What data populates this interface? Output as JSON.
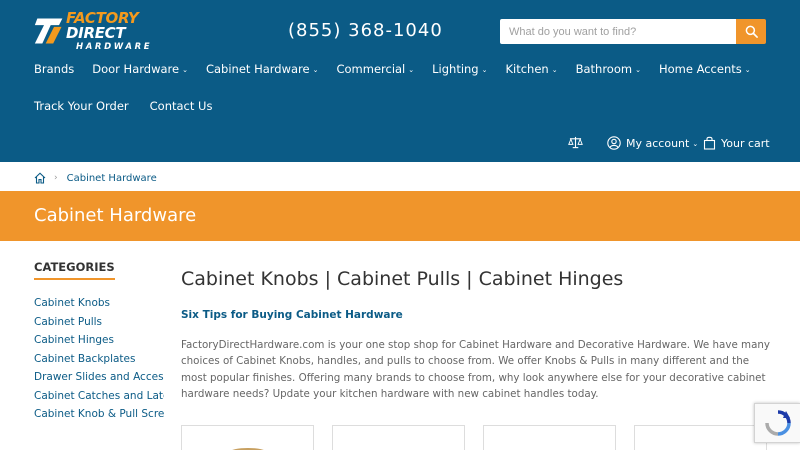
{
  "brand": {
    "logo_line1a": "FACTORY",
    "logo_line1b": "DIRECT",
    "logo_line2": "HARDWARE",
    "accent_color": "#f0952b",
    "primary_color": "#0b5b86"
  },
  "header": {
    "phone": "(855) 368-1040",
    "search_placeholder": "What do you want to find?",
    "search_icon": "search-icon"
  },
  "nav": {
    "row1": [
      {
        "label": "Brands",
        "dropdown": false
      },
      {
        "label": "Door Hardware",
        "dropdown": true
      },
      {
        "label": "Cabinet Hardware",
        "dropdown": true
      },
      {
        "label": "Commercial",
        "dropdown": true
      },
      {
        "label": "Lighting",
        "dropdown": true
      },
      {
        "label": "Kitchen",
        "dropdown": true
      },
      {
        "label": "Bathroom",
        "dropdown": true
      },
      {
        "label": "Home Accents",
        "dropdown": true
      }
    ],
    "row2": [
      {
        "label": "Track Your Order"
      },
      {
        "label": "Contact Us"
      }
    ]
  },
  "utility": {
    "compare_icon": "scale-icon",
    "account_label": "My account",
    "cart_label": "Your cart"
  },
  "breadcrumb": {
    "home_icon": "home-icon",
    "separator": "›",
    "current": "Cabinet Hardware"
  },
  "banner": {
    "title": "Cabinet Hardware"
  },
  "sidebar": {
    "title": "CATEGORIES",
    "items": [
      "Cabinet Knobs",
      "Cabinet Pulls",
      "Cabinet Hinges",
      "Cabinet Backplates",
      "Drawer Slides and Accessories",
      "Cabinet Catches and Latches",
      "Cabinet Knob & Pull Screws"
    ]
  },
  "main": {
    "title": "Cabinet Knobs | Cabinet Pulls | Cabinet Hinges",
    "subtitle": "Six Tips for Buying Cabinet Hardware",
    "paragraph": "FactoryDirectHardware.com is your one stop shop for Cabinet Hardware and Decorative Hardware. We have many choices of Cabinet Knobs, handles, and pulls to choose from. We offer Knobs & Pulls in many different and the most popular finishes. Offering many brands to choose from, why look anywhere else for your decorative cabinet hardware needs? Update your kitchen hardware with new cabinet handles today."
  }
}
